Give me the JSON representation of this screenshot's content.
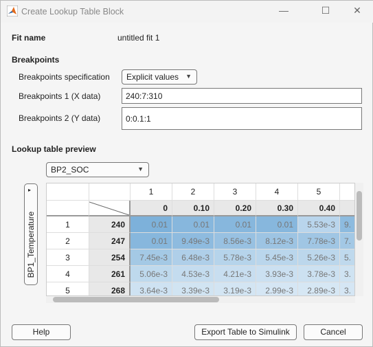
{
  "window": {
    "title": "Create Lookup Table Block",
    "minimize": "—",
    "maximize": "☐",
    "close": "✕"
  },
  "fit": {
    "label": "Fit name",
    "value": "untitled fit 1"
  },
  "breakpoints": {
    "heading": "Breakpoints",
    "spec_label": "Breakpoints specification",
    "spec_value": "Explicit values",
    "bp1_label": "Breakpoints 1 (X data)",
    "bp1_value": "240:7:310",
    "bp2_label": "Breakpoints 2 (Y data)",
    "bp2_value": "0:0.1:1"
  },
  "preview": {
    "heading": "Lookup table preview",
    "column_select": "BP2_SOC",
    "row_axis_label": "BP1_Temperature",
    "col_indices": [
      "1",
      "2",
      "3",
      "4",
      "5",
      ""
    ],
    "col_breakpoints": [
      "0",
      "0.10",
      "0.20",
      "0.30",
      "0.40",
      ""
    ],
    "rows": [
      {
        "index": "1",
        "bp": "240",
        "values": [
          "0.01",
          "0.01",
          "0.01",
          "0.01",
          "5.53e-3",
          "9."
        ],
        "levels": [
          0.011,
          0.0101,
          0.0101,
          0.0101,
          0.00553,
          0.0095
        ]
      },
      {
        "index": "2",
        "bp": "247",
        "values": [
          "0.01",
          "9.49e-3",
          "8.56e-3",
          "8.12e-3",
          "7.78e-3",
          "7."
        ],
        "levels": [
          0.0101,
          0.00949,
          0.00856,
          0.00812,
          0.00778,
          0.0075
        ]
      },
      {
        "index": "3",
        "bp": "254",
        "values": [
          "7.45e-3",
          "6.48e-3",
          "5.78e-3",
          "5.45e-3",
          "5.26e-3",
          "5."
        ],
        "levels": [
          0.00745,
          0.00648,
          0.00578,
          0.00545,
          0.00526,
          0.005
        ]
      },
      {
        "index": "4",
        "bp": "261",
        "values": [
          "5.06e-3",
          "4.53e-3",
          "4.21e-3",
          "3.93e-3",
          "3.78e-3",
          "3."
        ],
        "levels": [
          0.00506,
          0.00453,
          0.00421,
          0.00393,
          0.00378,
          0.0035
        ]
      },
      {
        "index": "5",
        "bp": "268",
        "values": [
          "3.64e-3",
          "3.39e-3",
          "3.19e-3",
          "2.99e-3",
          "2.89e-3",
          "3."
        ],
        "levels": [
          0.00364,
          0.00339,
          0.00319,
          0.00299,
          0.00289,
          0.003
        ]
      }
    ]
  },
  "buttons": {
    "help": "Help",
    "export": "Export Table to Simulink",
    "cancel": "Cancel"
  },
  "colors": {
    "high": "#7db1da",
    "low": "#d6e7f4"
  }
}
